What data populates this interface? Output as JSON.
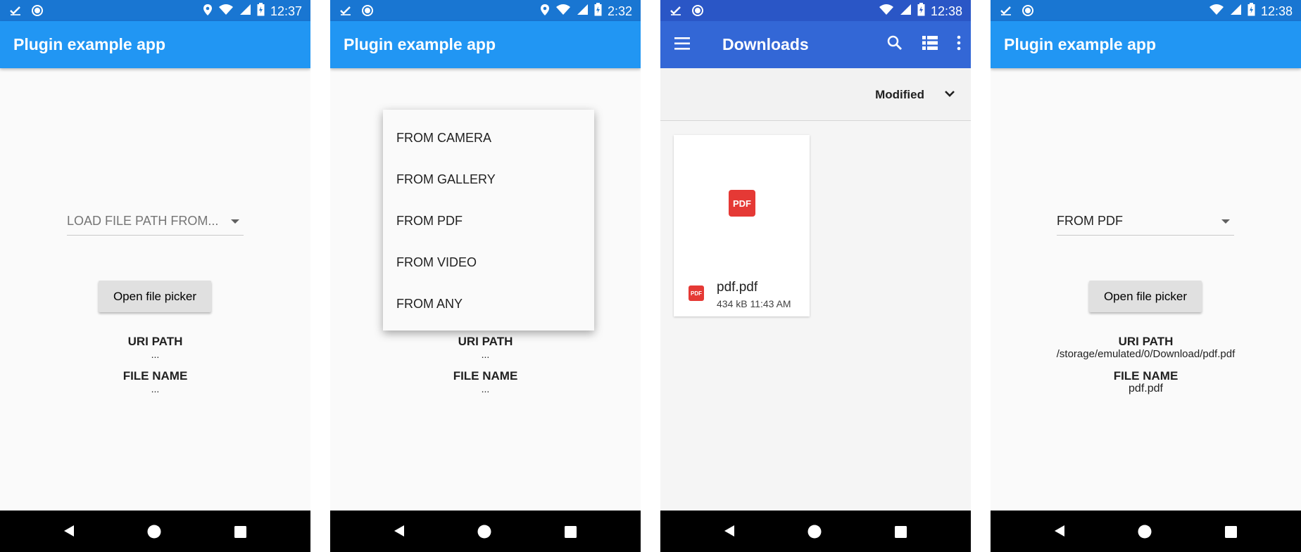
{
  "colors": {
    "primary": "#2196f3",
    "status_bar": "#1976d2",
    "files_app_bar": "#3367d6",
    "pdf_red": "#e53935",
    "button_grey": "#e0e0e0"
  },
  "icons": {
    "status_left": [
      "check-icon",
      "circle-icon"
    ],
    "status_right": [
      "location-icon",
      "wifi-icon",
      "signal-icon",
      "battery-icon"
    ],
    "nav": [
      "back-icon",
      "home-icon",
      "recent-apps-icon"
    ]
  },
  "screens": [
    {
      "status_time": "12:37",
      "app_title": "Plugin example app",
      "dropdown_label": "LOAD FILE PATH FROM...",
      "button_label": "Open file picker",
      "uri_label": "URI PATH",
      "uri_value": "...",
      "file_label": "FILE NAME",
      "file_value": "..."
    },
    {
      "status_time": "2:32",
      "app_title": "Plugin example app",
      "menu_items": [
        "FROM CAMERA",
        "FROM GALLERY",
        "FROM PDF",
        "FROM VIDEO",
        "FROM ANY"
      ],
      "uri_label": "URI PATH",
      "uri_value": "...",
      "file_label": "FILE NAME",
      "file_value": "..."
    },
    {
      "status_time": "12:38",
      "app_title": "Downloads",
      "sort_label": "Modified",
      "file": {
        "icon_text": "PDF",
        "name": "pdf.pdf",
        "meta": "434 kB 11:43 AM"
      }
    },
    {
      "status_time": "12:38",
      "app_title": "Plugin example app",
      "dropdown_label": "FROM PDF",
      "button_label": "Open file picker",
      "uri_label": "URI PATH",
      "uri_value": "/storage/emulated/0/Download/pdf.pdf",
      "file_label": "FILE NAME",
      "file_value": "pdf.pdf"
    }
  ]
}
